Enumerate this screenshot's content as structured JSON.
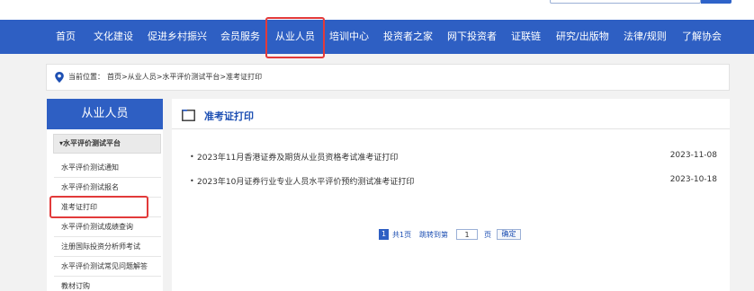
{
  "nav": {
    "items": [
      {
        "label": "首页"
      },
      {
        "label": "文化建设"
      },
      {
        "label": "促进乡村振兴"
      },
      {
        "label": "会员服务"
      },
      {
        "label": "从业人员"
      },
      {
        "label": "培训中心"
      },
      {
        "label": "投资者之家"
      },
      {
        "label": "网下投资者"
      },
      {
        "label": "证联链"
      },
      {
        "label": "研究/出版物"
      },
      {
        "label": "法律/规则"
      },
      {
        "label": "了解协会"
      }
    ],
    "active": "从业人员"
  },
  "breadcrumb": {
    "label": "当前位置：",
    "path": "首页>从业人员>水平评价测试平台>准考证打印"
  },
  "sidebar": {
    "title": "从业人员",
    "section": "▾水平评价测试平台",
    "items": [
      {
        "label": "水平评价测试通知"
      },
      {
        "label": "水平评价测试报名"
      },
      {
        "label": "准考证打印"
      },
      {
        "label": "水平评价测试成绩查询"
      },
      {
        "label": "注册国际投资分析师考试"
      },
      {
        "label": "水平评价测试常见问题解答"
      },
      {
        "label": "教材订购"
      }
    ],
    "active": "准考证打印"
  },
  "main": {
    "title": "准考证打印",
    "rows": [
      {
        "bullet": "•",
        "title": "2023年11月香港证券及期货从业员资格考试准考证打印",
        "date": "2023-11-08"
      },
      {
        "bullet": "•",
        "title": "2023年10月证券行业专业人员水平评价预约测试准考证打印",
        "date": "2023-10-18"
      }
    ]
  },
  "pager": {
    "current": "1",
    "total": "共1页",
    "jump": "跳转到第",
    "input_value": "1",
    "unit": "页",
    "button": "确定"
  },
  "colors": {
    "brand": "#2e5fc3",
    "highlight": "#e23a3a",
    "title_blue": "#1d4fb3"
  }
}
